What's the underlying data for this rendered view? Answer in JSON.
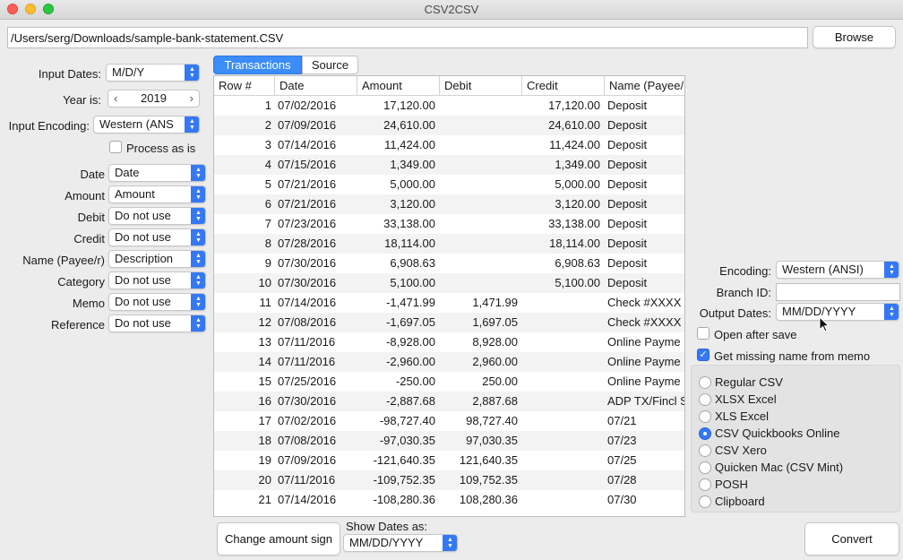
{
  "window": {
    "title": "CSV2CSV"
  },
  "file": {
    "path": "/Users/serg/Downloads/sample-bank-statement.CSV",
    "browse_label": "Browse"
  },
  "left_panel": {
    "input_dates_label": "Input Dates:",
    "input_dates_value": "M/D/Y",
    "year_label": "Year is:",
    "year_value": "2019",
    "encoding_label": "Input Encoding:",
    "encoding_value": "Western (ANS",
    "process_as_is_label": "Process as is",
    "mappings": [
      {
        "label": "Date",
        "value": "Date"
      },
      {
        "label": "Amount",
        "value": "Amount"
      },
      {
        "label": "Debit",
        "value": "Do not use"
      },
      {
        "label": "Credit",
        "value": "Do not use"
      },
      {
        "label": "Name (Payee/r)",
        "value": "Description"
      },
      {
        "label": "Category",
        "value": "Do not use"
      },
      {
        "label": "Memo",
        "value": "Do not use"
      },
      {
        "label": "Reference",
        "value": "Do not use"
      }
    ]
  },
  "tabs": {
    "transactions": "Transactions",
    "source": "Source"
  },
  "table": {
    "headers": [
      "Row #",
      "Date",
      "Amount",
      "Debit",
      "Credit",
      "Name (Payee/"
    ],
    "rows": [
      [
        "1",
        "07/02/2016",
        "17,120.00",
        "",
        "17,120.00",
        "Deposit"
      ],
      [
        "2",
        "07/09/2016",
        "24,610.00",
        "",
        "24,610.00",
        "Deposit"
      ],
      [
        "3",
        "07/14/2016",
        "11,424.00",
        "",
        "11,424.00",
        "Deposit"
      ],
      [
        "4",
        "07/15/2016",
        "1,349.00",
        "",
        "1,349.00",
        "Deposit"
      ],
      [
        "5",
        "07/21/2016",
        "5,000.00",
        "",
        "5,000.00",
        "Deposit"
      ],
      [
        "6",
        "07/21/2016",
        "3,120.00",
        "",
        "3,120.00",
        "Deposit"
      ],
      [
        "7",
        "07/23/2016",
        "33,138.00",
        "",
        "33,138.00",
        "Deposit"
      ],
      [
        "8",
        "07/28/2016",
        "18,114.00",
        "",
        "18,114.00",
        "Deposit"
      ],
      [
        "9",
        "07/30/2016",
        "6,908.63",
        "",
        "6,908.63",
        "Deposit"
      ],
      [
        "10",
        "07/30/2016",
        "5,100.00",
        "",
        "5,100.00",
        "Deposit"
      ],
      [
        "11",
        "07/14/2016",
        "-1,471.99",
        "1,471.99",
        "",
        "Check #XXXX"
      ],
      [
        "12",
        "07/08/2016",
        "-1,697.05",
        "1,697.05",
        "",
        "Check #XXXX"
      ],
      [
        "13",
        "07/11/2016",
        "-8,928.00",
        "8,928.00",
        "",
        "Online Payme"
      ],
      [
        "14",
        "07/11/2016",
        "-2,960.00",
        "2,960.00",
        "",
        "Online Payme"
      ],
      [
        "15",
        "07/25/2016",
        "-250.00",
        "250.00",
        "",
        "Online Payme"
      ],
      [
        "16",
        "07/30/2016",
        "-2,887.68",
        "2,887.68",
        "",
        "ADP TX/Fincl S"
      ],
      [
        "17",
        "07/02/2016",
        "-98,727.40",
        "98,727.40",
        "",
        "07/21"
      ],
      [
        "18",
        "07/08/2016",
        "-97,030.35",
        "97,030.35",
        "",
        "07/23"
      ],
      [
        "19",
        "07/09/2016",
        "-121,640.35",
        "121,640.35",
        "",
        "07/25"
      ],
      [
        "20",
        "07/11/2016",
        "-109,752.35",
        "109,752.35",
        "",
        "07/28"
      ],
      [
        "21",
        "07/14/2016",
        "-108,280.36",
        "108,280.36",
        "",
        "07/30"
      ]
    ]
  },
  "right_panel": {
    "encoding_label": "Encoding:",
    "encoding_value": "Western (ANSI)",
    "branch_label": "Branch ID:",
    "branch_value": "",
    "output_dates_label": "Output Dates:",
    "output_dates_value": "MM/DD/YYYY",
    "open_after_save_label": "Open after save",
    "open_after_save_checked": false,
    "missing_name_label": "Get missing name from memo",
    "missing_name_checked": true,
    "formats": [
      {
        "label": "Regular CSV",
        "selected": false
      },
      {
        "label": "XLSX Excel",
        "selected": false
      },
      {
        "label": "XLS Excel",
        "selected": false
      },
      {
        "label": "CSV Quickbooks Online",
        "selected": true
      },
      {
        "label": "CSV Xero",
        "selected": false
      },
      {
        "label": "Quicken Mac (CSV Mint)",
        "selected": false
      },
      {
        "label": "POSH",
        "selected": false
      },
      {
        "label": "Clipboard",
        "selected": false
      }
    ]
  },
  "bottom": {
    "change_sign_label": "Change amount sign",
    "show_dates_label": "Show Dates as:",
    "show_dates_value": "MM/DD/YYYY",
    "convert_label": "Convert"
  },
  "icons": {
    "popup": "up-down-arrows-icon",
    "pointer": "mouse-pointer-icon"
  },
  "colors": {
    "accent": "#3478f6",
    "tab_active": "#3c8df8",
    "row_alt": "#f3f3f3"
  }
}
